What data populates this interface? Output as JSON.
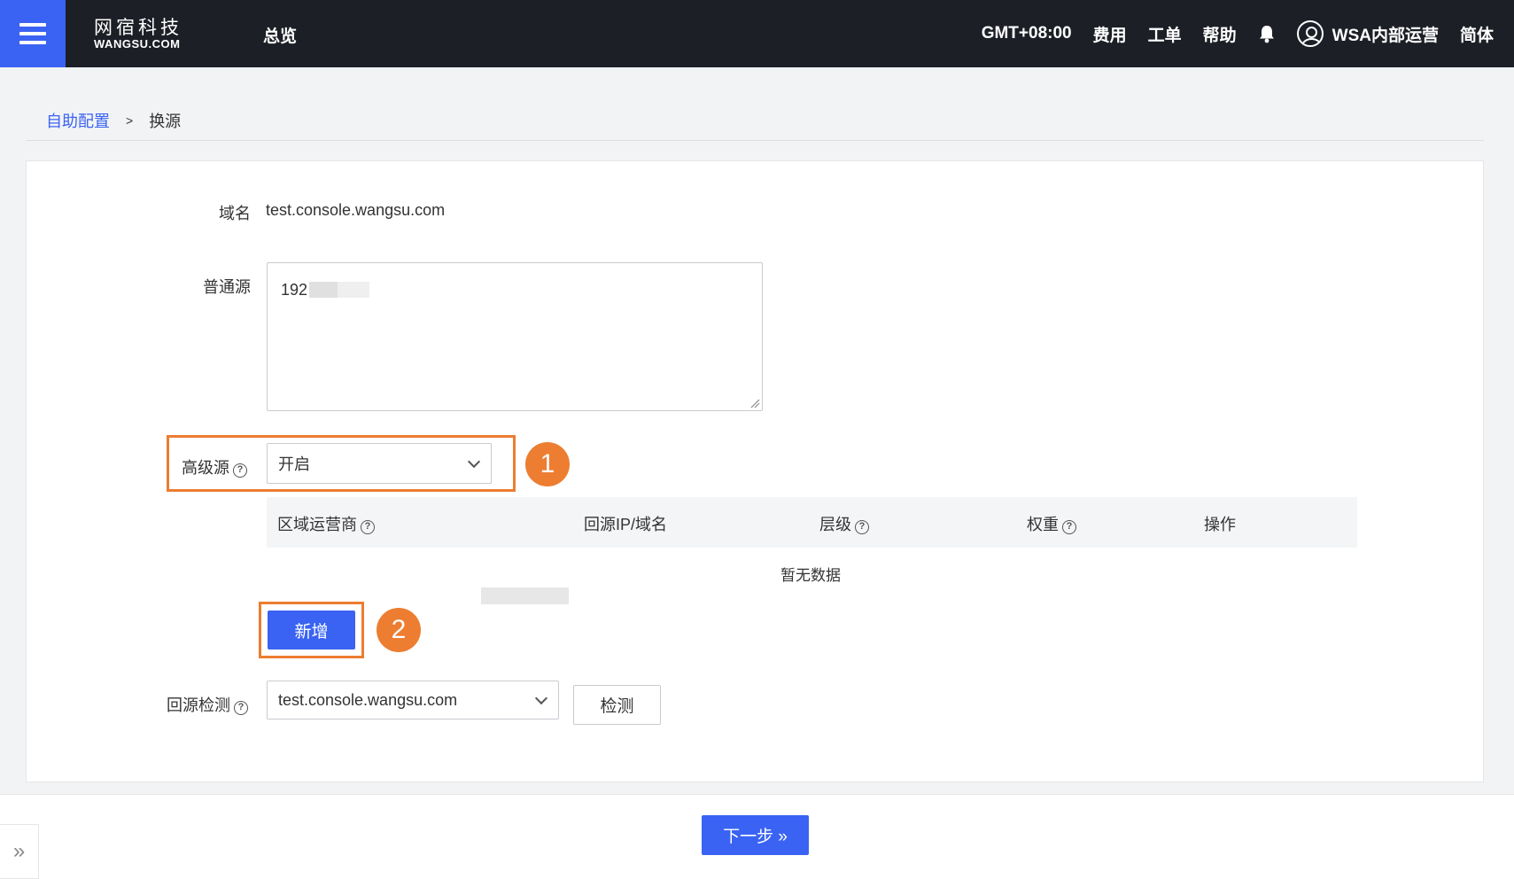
{
  "header": {
    "logo_cn": "网宿科技",
    "logo_en": "WANGSU.COM",
    "nav_overview": "总览",
    "timezone": "GMT+08:00",
    "fees": "费用",
    "tickets": "工单",
    "help": "帮助",
    "bell_icon": "bell-icon",
    "user_icon": "user-circle-icon",
    "user_name": "WSA内部运营",
    "language": "简体"
  },
  "breadcrumb": {
    "parent": "自助配置",
    "separator": ">",
    "current": "换源"
  },
  "form": {
    "domain_label": "域名",
    "domain_value": "test.console.wangsu.com",
    "normal_origin_label": "普通源",
    "normal_origin_value": "192",
    "advanced_origin_label": "高级源",
    "advanced_origin_value": "开启",
    "table": {
      "columns": [
        "区域运营商",
        "回源IP/域名",
        "层级",
        "权重",
        "操作"
      ],
      "empty_text": "暂无数据"
    },
    "add_button": "新增",
    "origin_check_label": "回源检测",
    "origin_check_value": "test.console.wangsu.com",
    "check_button": "检测"
  },
  "annotations": {
    "step1": "1",
    "step2": "2",
    "highlight_color": "#ed7d31"
  },
  "footer": {
    "next_button": "下一步 »",
    "expand_icon": "double-chevron-right-icon",
    "expand_glyph": "»"
  },
  "colors": {
    "primary": "#3a63f3",
    "topbar": "#1c1f26",
    "annotation": "#ed7d31"
  }
}
